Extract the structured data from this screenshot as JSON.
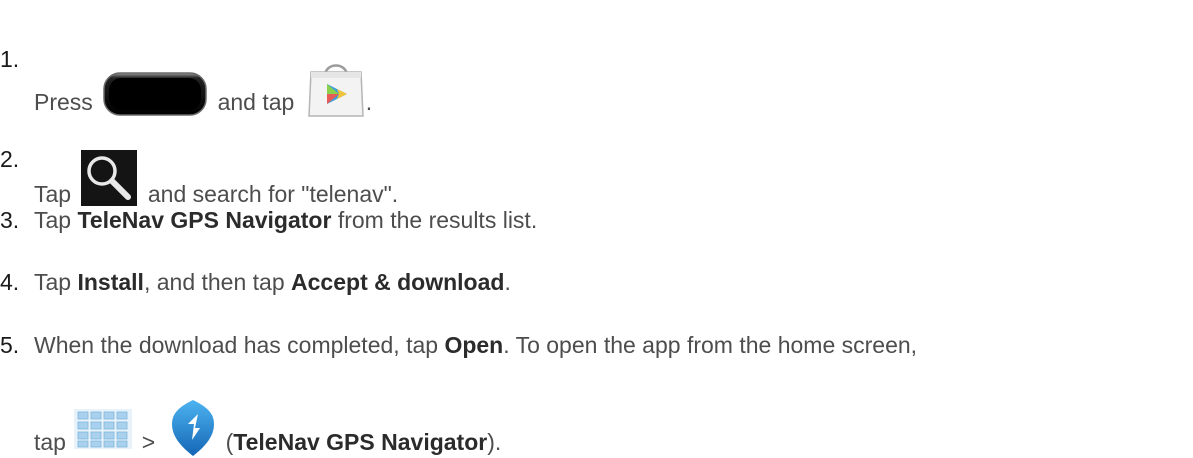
{
  "steps": [
    {
      "number": "1.",
      "parts": {
        "t1": "Press",
        "t2": "and tap",
        "t3": "."
      },
      "icons": [
        "home-key-icon",
        "play-store-icon"
      ]
    },
    {
      "number": "2.",
      "parts": {
        "t1": "Tap",
        "t2": "and search for \"telenav\"."
      },
      "icons": [
        "search-icon"
      ]
    },
    {
      "number": "3.",
      "parts": {
        "t1": "Tap",
        "b1": "TeleNav GPS Navigator",
        "t2": "from the results list."
      }
    },
    {
      "number": "4.",
      "parts": {
        "t1": "Tap",
        "b1": "Install",
        "t2": ", and then tap",
        "b2": "Accept & download",
        "t3": "."
      }
    },
    {
      "number": "5.",
      "parts": {
        "t1": "When the download has completed, tap",
        "b1": "Open",
        "t2": ". To open the app from the home screen,",
        "t3": "tap",
        "t4": ">",
        "t5": "(",
        "b2": "TeleNav GPS Navigator",
        "t6": ")."
      },
      "icons": [
        "apps-grid-icon",
        "telenav-app-icon"
      ]
    }
  ]
}
